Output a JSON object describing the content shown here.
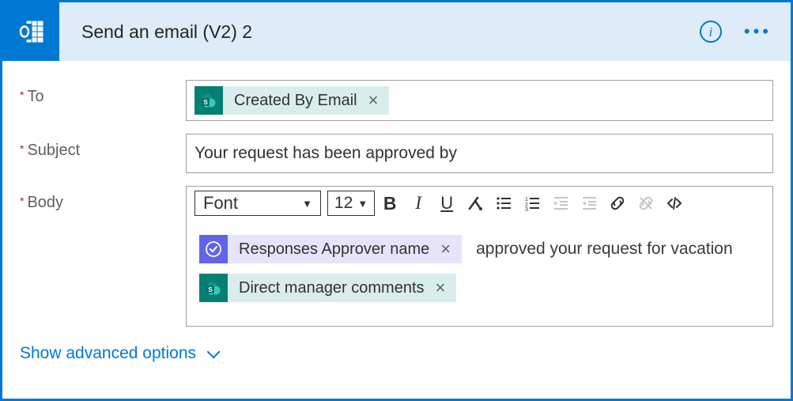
{
  "header": {
    "title": "Send an email (V2) 2"
  },
  "fields": {
    "to": {
      "label": "To",
      "token": {
        "type": "sharepoint",
        "label": "Created By Email"
      }
    },
    "subject": {
      "label": "Subject",
      "value": "Your request has been approved by"
    },
    "body": {
      "label": "Body",
      "toolbar": {
        "font_label": "Font",
        "size_label": "12"
      },
      "line1_token": {
        "type": "approvals",
        "label": "Responses Approver name"
      },
      "line1_text": "approved your request for vacation",
      "line2_token": {
        "type": "sharepoint",
        "label": "Direct manager comments"
      }
    }
  },
  "advanced_label": "Show advanced options"
}
